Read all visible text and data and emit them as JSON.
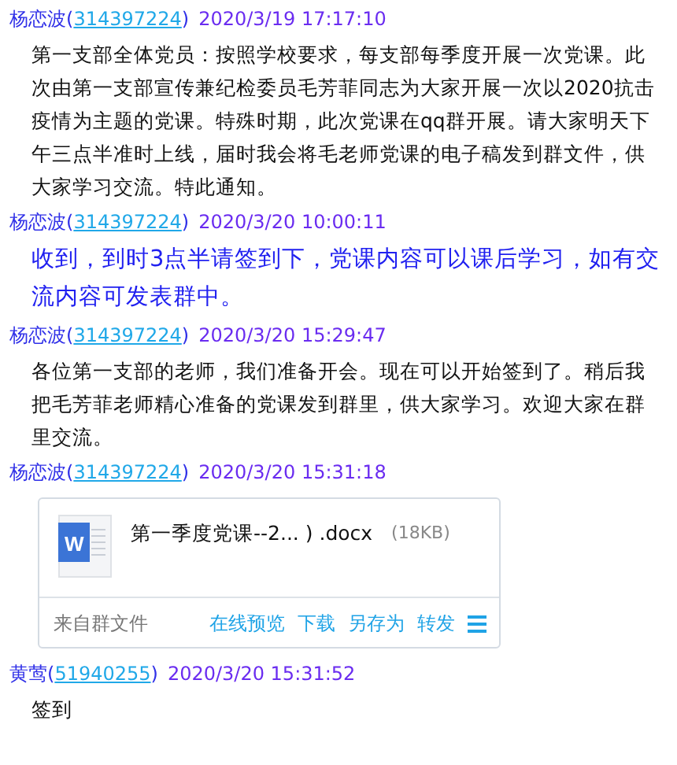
{
  "messages": [
    {
      "kind": "text",
      "sender": "杨恋波(",
      "qq": "314397224",
      "close": ")",
      "time": "2020/3/19 17:17:10",
      "text": "第一支部全体党员：按照学校要求，每支部每季度开展一次党课。此次由第一支部宣传兼纪检委员毛芳菲同志为大家开展一次以2020抗击疫情为主题的党课。特殊时期，此次党课在qq群开展。请大家明天下午三点半准时上线，届时我会将毛老师党课的电子稿发到群文件，供大家学习交流。特此通知。"
    },
    {
      "kind": "highlight",
      "sender": "杨恋波(",
      "qq": "314397224",
      "close": ")",
      "time": "2020/3/20 10:00:11",
      "text": "收到，到时3点半请签到下，党课内容可以课后学习，如有交流内容可发表群中。"
    },
    {
      "kind": "text",
      "sender": "杨恋波(",
      "qq": "314397224",
      "close": ")",
      "time": "2020/3/20 15:29:47",
      "text": "各位第一支部的老师，我们准备开会。现在可以开始签到了。稍后我把毛芳菲老师精心准备的党课发到群里，供大家学习。欢迎大家在群里交流。"
    },
    {
      "kind": "file",
      "sender": "杨恋波(",
      "qq": "314397224",
      "close": ")",
      "time": "2020/3/20 15:31:18",
      "file_icon_letter": "W",
      "file_name": "第一季度党课--2... ) .docx",
      "file_size": "(18KB)",
      "source": "来自群文件",
      "actions": [
        "在线预览",
        "下载",
        "另存为",
        "转发"
      ]
    },
    {
      "kind": "text",
      "sender": "黄莺(",
      "qq": "51940255",
      "close": ")",
      "time": "2020/3/20 15:31:52",
      "text": "签到"
    }
  ]
}
